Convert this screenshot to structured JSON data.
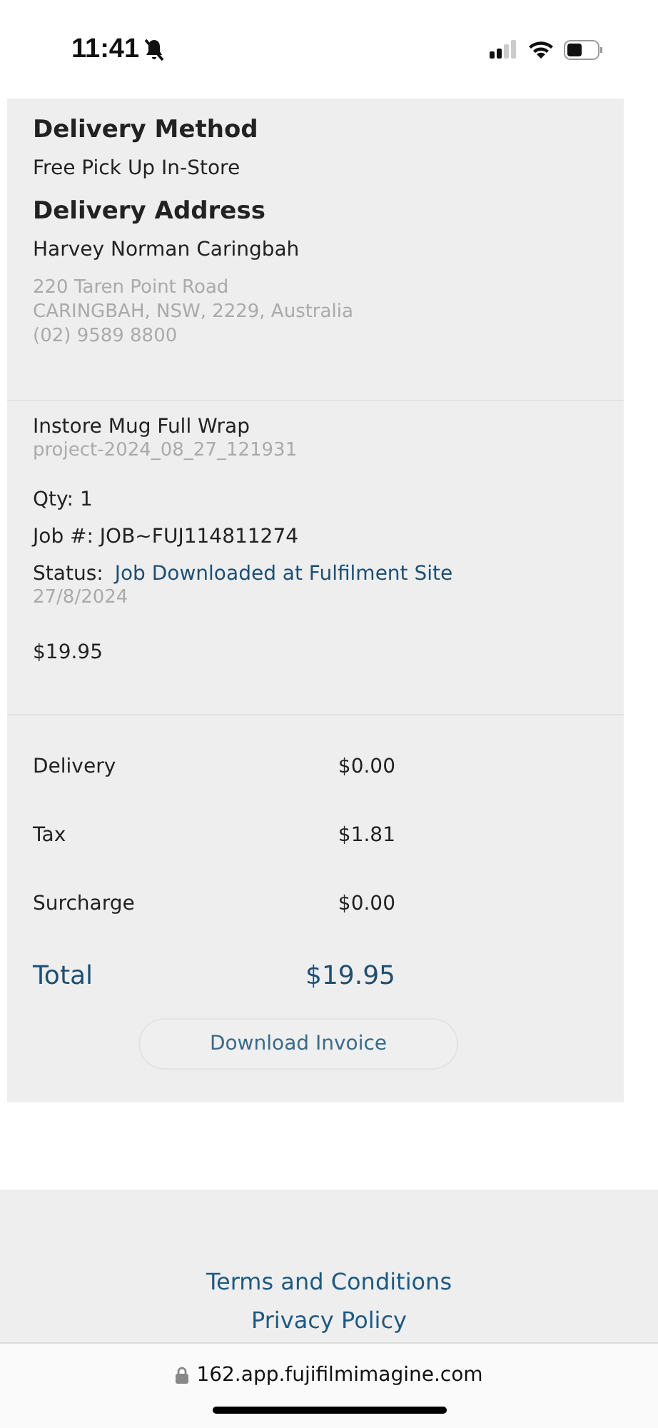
{
  "status_bar": {
    "time": "11:41"
  },
  "delivery": {
    "method_heading": "Delivery Method",
    "method": "Free Pick Up In-Store",
    "address_heading": "Delivery Address",
    "store": "Harvey Norman Caringbah",
    "address_lines": [
      "220 Taren Point Road",
      "CARINGBAH, NSW, 2229, Australia",
      "(02) 9589 8800"
    ]
  },
  "item": {
    "name": "Instore Mug Full Wrap",
    "project": "project-2024_08_27_121931",
    "qty": "Qty: 1",
    "job": "Job #: JOB~FUJ114811274",
    "status_label": "Status:",
    "status": "Job Downloaded at Fulfilment Site",
    "date": "27/8/2024",
    "price": "$19.95"
  },
  "totals": [
    {
      "label": "Delivery",
      "value": "$0.00",
      "kind": "line"
    },
    {
      "label": "Tax",
      "value": "$1.81",
      "kind": "line"
    },
    {
      "label": "Surcharge",
      "value": "$0.00",
      "kind": "line"
    },
    {
      "label": "Total",
      "value": "$19.95",
      "kind": "total"
    }
  ],
  "download_button": "Download Invoice",
  "footer_links": [
    "Terms and Conditions",
    "Privacy Policy"
  ],
  "browser": {
    "url": "162.app.fujifilmimagine.com"
  }
}
